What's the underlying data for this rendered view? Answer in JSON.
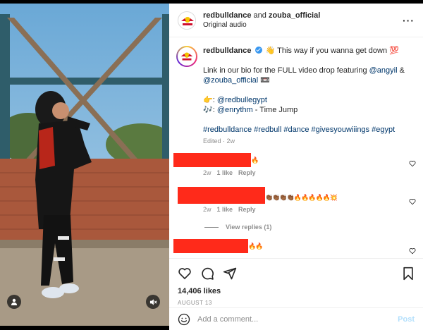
{
  "header": {
    "author1": "redbulldance",
    "joiner": " and ",
    "author2": "zouba_official",
    "audio": "Original audio",
    "more_icon": "more-horizontal-icon"
  },
  "caption": {
    "username": "redbulldance",
    "line1": "👋 This way if you wanna get down 💯",
    "line2_prefix": "Link in our bio for the FULL video drop featuring ",
    "mention_angyil": "@angyil",
    "line2_amp": " &",
    "mention_zouba": "@zouba_official",
    "line2_suffix": " 📼",
    "line3_prefix": "👉: ",
    "mention_rbegypt": "@redbullegypt",
    "line4_prefix": "🎶: ",
    "mention_enrythm": "@enrythm",
    "line4_suffix": " - Time Jump",
    "hashtags": "#redbulldance #redbull #dance #givesyouwiiings #egypt",
    "edited": "Edited · 2w"
  },
  "comments": [
    {
      "emoji": "🔥",
      "age": "2w",
      "likes": "1 like",
      "reply": "Reply"
    },
    {
      "emoji": "👏🏾👏🏾👏🏾👏🏾🔥🔥🔥🔥🔥💥",
      "age": "2w",
      "likes": "1 like",
      "reply": "Reply",
      "view_replies": "View replies (1)"
    },
    {
      "emoji": "🔥🔥",
      "age": "",
      "likes": "",
      "reply": ""
    }
  ],
  "actions": {
    "likes": "14,406 likes",
    "date": "AUGUST 13"
  },
  "add_comment": {
    "placeholder": "Add a comment...",
    "post_label": "Post"
  },
  "colors": {
    "redaction": "#ff2a1a",
    "link": "#00376b",
    "verified": "#3897f0",
    "post_disabled": "#b2dffc"
  }
}
